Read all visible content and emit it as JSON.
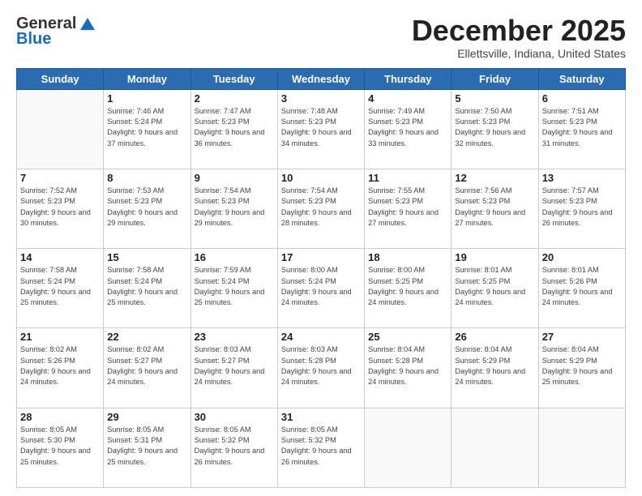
{
  "logo": {
    "general": "General",
    "blue": "Blue"
  },
  "header": {
    "month": "December 2025",
    "location": "Ellettsville, Indiana, United States"
  },
  "days_of_week": [
    "Sunday",
    "Monday",
    "Tuesday",
    "Wednesday",
    "Thursday",
    "Friday",
    "Saturday"
  ],
  "weeks": [
    [
      {
        "day": "",
        "info": ""
      },
      {
        "day": "1",
        "info": "Sunrise: 7:46 AM\nSunset: 5:24 PM\nDaylight: 9 hours\nand 37 minutes."
      },
      {
        "day": "2",
        "info": "Sunrise: 7:47 AM\nSunset: 5:23 PM\nDaylight: 9 hours\nand 36 minutes."
      },
      {
        "day": "3",
        "info": "Sunrise: 7:48 AM\nSunset: 5:23 PM\nDaylight: 9 hours\nand 34 minutes."
      },
      {
        "day": "4",
        "info": "Sunrise: 7:49 AM\nSunset: 5:23 PM\nDaylight: 9 hours\nand 33 minutes."
      },
      {
        "day": "5",
        "info": "Sunrise: 7:50 AM\nSunset: 5:23 PM\nDaylight: 9 hours\nand 32 minutes."
      },
      {
        "day": "6",
        "info": "Sunrise: 7:51 AM\nSunset: 5:23 PM\nDaylight: 9 hours\nand 31 minutes."
      }
    ],
    [
      {
        "day": "7",
        "info": "Sunrise: 7:52 AM\nSunset: 5:23 PM\nDaylight: 9 hours\nand 30 minutes."
      },
      {
        "day": "8",
        "info": "Sunrise: 7:53 AM\nSunset: 5:23 PM\nDaylight: 9 hours\nand 29 minutes."
      },
      {
        "day": "9",
        "info": "Sunrise: 7:54 AM\nSunset: 5:23 PM\nDaylight: 9 hours\nand 29 minutes."
      },
      {
        "day": "10",
        "info": "Sunrise: 7:54 AM\nSunset: 5:23 PM\nDaylight: 9 hours\nand 28 minutes."
      },
      {
        "day": "11",
        "info": "Sunrise: 7:55 AM\nSunset: 5:23 PM\nDaylight: 9 hours\nand 27 minutes."
      },
      {
        "day": "12",
        "info": "Sunrise: 7:56 AM\nSunset: 5:23 PM\nDaylight: 9 hours\nand 27 minutes."
      },
      {
        "day": "13",
        "info": "Sunrise: 7:57 AM\nSunset: 5:23 PM\nDaylight: 9 hours\nand 26 minutes."
      }
    ],
    [
      {
        "day": "14",
        "info": "Sunrise: 7:58 AM\nSunset: 5:24 PM\nDaylight: 9 hours\nand 25 minutes."
      },
      {
        "day": "15",
        "info": "Sunrise: 7:58 AM\nSunset: 5:24 PM\nDaylight: 9 hours\nand 25 minutes."
      },
      {
        "day": "16",
        "info": "Sunrise: 7:59 AM\nSunset: 5:24 PM\nDaylight: 9 hours\nand 25 minutes."
      },
      {
        "day": "17",
        "info": "Sunrise: 8:00 AM\nSunset: 5:24 PM\nDaylight: 9 hours\nand 24 minutes."
      },
      {
        "day": "18",
        "info": "Sunrise: 8:00 AM\nSunset: 5:25 PM\nDaylight: 9 hours\nand 24 minutes."
      },
      {
        "day": "19",
        "info": "Sunrise: 8:01 AM\nSunset: 5:25 PM\nDaylight: 9 hours\nand 24 minutes."
      },
      {
        "day": "20",
        "info": "Sunrise: 8:01 AM\nSunset: 5:26 PM\nDaylight: 9 hours\nand 24 minutes."
      }
    ],
    [
      {
        "day": "21",
        "info": "Sunrise: 8:02 AM\nSunset: 5:26 PM\nDaylight: 9 hours\nand 24 minutes."
      },
      {
        "day": "22",
        "info": "Sunrise: 8:02 AM\nSunset: 5:27 PM\nDaylight: 9 hours\nand 24 minutes."
      },
      {
        "day": "23",
        "info": "Sunrise: 8:03 AM\nSunset: 5:27 PM\nDaylight: 9 hours\nand 24 minutes."
      },
      {
        "day": "24",
        "info": "Sunrise: 8:03 AM\nSunset: 5:28 PM\nDaylight: 9 hours\nand 24 minutes."
      },
      {
        "day": "25",
        "info": "Sunrise: 8:04 AM\nSunset: 5:28 PM\nDaylight: 9 hours\nand 24 minutes."
      },
      {
        "day": "26",
        "info": "Sunrise: 8:04 AM\nSunset: 5:29 PM\nDaylight: 9 hours\nand 24 minutes."
      },
      {
        "day": "27",
        "info": "Sunrise: 8:04 AM\nSunset: 5:29 PM\nDaylight: 9 hours\nand 25 minutes."
      }
    ],
    [
      {
        "day": "28",
        "info": "Sunrise: 8:05 AM\nSunset: 5:30 PM\nDaylight: 9 hours\nand 25 minutes."
      },
      {
        "day": "29",
        "info": "Sunrise: 8:05 AM\nSunset: 5:31 PM\nDaylight: 9 hours\nand 25 minutes."
      },
      {
        "day": "30",
        "info": "Sunrise: 8:05 AM\nSunset: 5:32 PM\nDaylight: 9 hours\nand 26 minutes."
      },
      {
        "day": "31",
        "info": "Sunrise: 8:05 AM\nSunset: 5:32 PM\nDaylight: 9 hours\nand 26 minutes."
      },
      {
        "day": "",
        "info": ""
      },
      {
        "day": "",
        "info": ""
      },
      {
        "day": "",
        "info": ""
      }
    ]
  ]
}
